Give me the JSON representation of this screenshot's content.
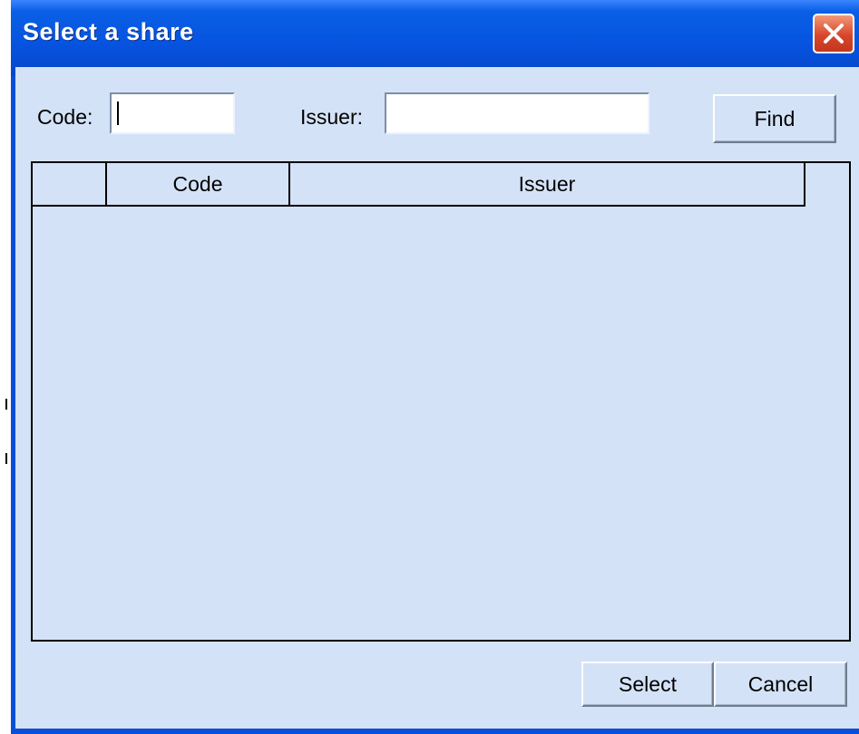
{
  "window": {
    "title": "Select a share"
  },
  "search": {
    "code_label": "Code:",
    "code_value": "",
    "issuer_label": "Issuer:",
    "issuer_value": "",
    "find_label": "Find"
  },
  "table": {
    "columns": [
      "",
      "Code",
      "Issuer"
    ],
    "rows": []
  },
  "footer": {
    "select_label": "Select",
    "cancel_label": "Cancel"
  },
  "colors": {
    "title_bar": "#0a5fe6",
    "client_bg": "#d4e2f7",
    "close_button": "#d9462a"
  }
}
